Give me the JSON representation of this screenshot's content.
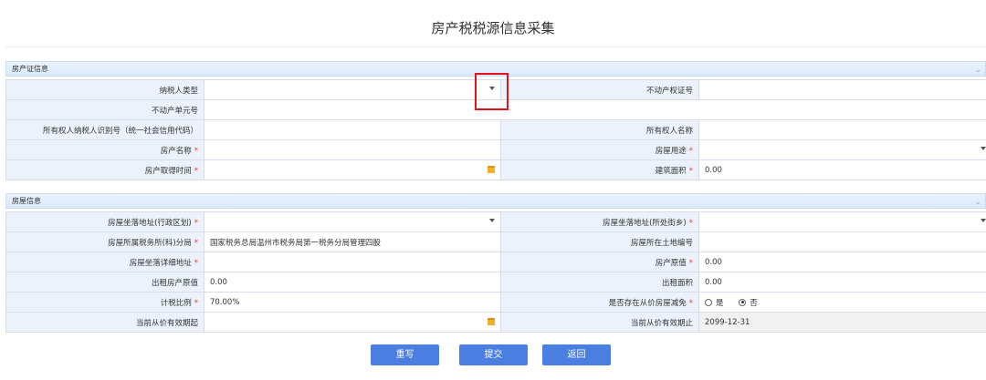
{
  "page_title": "房产税税源信息采集",
  "sections": {
    "property_cert": {
      "title": "房产证信息",
      "chevron_icon": "chevron-down-icon"
    },
    "house_info": {
      "title": "房屋信息",
      "chevron_icon": "chevron-down-icon"
    }
  },
  "property_cert": {
    "taxpayer_type": {
      "label": "纳税人类型",
      "value": ""
    },
    "realty_cert_no": {
      "label": "不动产权证号",
      "value": ""
    },
    "realty_unit_no": {
      "label": "不动产单元号",
      "value": ""
    },
    "owner_id": {
      "label": "所有权人纳税人识别号（统一社会信用代码）",
      "value": ""
    },
    "owner_name": {
      "label": "所有权人名称",
      "value": ""
    },
    "property_name": {
      "label": "房产名称",
      "required_mark": "*",
      "value": ""
    },
    "house_use": {
      "label": "房屋用途",
      "required_mark": "*",
      "value": ""
    },
    "acquire_time": {
      "label": "房产取得时间",
      "required_mark": "*",
      "value": ""
    },
    "floor_area": {
      "label": "建筑面积",
      "required_mark": "*",
      "value": "0.00"
    }
  },
  "house_info": {
    "location_district": {
      "label": "房屋坐落地址(行政区划)",
      "required_mark": "*",
      "value": ""
    },
    "location_street": {
      "label": "房屋坐落地址(所处街乡)",
      "required_mark": "*",
      "value": ""
    },
    "tax_office": {
      "label": "房屋所属税务所(科)分局",
      "required_mark": "*",
      "value": "国家税务总局温州市税务局第一税务分局管理四股"
    },
    "land_no": {
      "label": "房屋所在土地编号",
      "value": ""
    },
    "detail_address": {
      "label": "房屋坐落详细地址",
      "required_mark": "*",
      "value": ""
    },
    "original_value": {
      "label": "房产原值",
      "required_mark": "*",
      "value": "0.00"
    },
    "rent_original_value": {
      "label": "出租房产原值",
      "value": "0.00"
    },
    "rent_area": {
      "label": "出租面积",
      "value": "0.00"
    },
    "tax_ratio": {
      "label": "计税比例",
      "required_mark": "*",
      "value": "70.00%"
    },
    "relief": {
      "label": "是否存在从价房屋减免",
      "required_mark": "*",
      "options": [
        "是",
        "否"
      ],
      "selected": "否"
    },
    "valid_from": {
      "label": "当前从价有效期起",
      "value": ""
    },
    "valid_to": {
      "label": "当前从价有效期止",
      "value": "2099-12-31"
    }
  },
  "buttons": {
    "reset": "重写",
    "submit": "提交",
    "back": "返回"
  },
  "colors": {
    "button": "#4a7ee0",
    "label_bg": "#ebf2fb",
    "highlight": "#e0151a",
    "required": "#e03c3c"
  }
}
